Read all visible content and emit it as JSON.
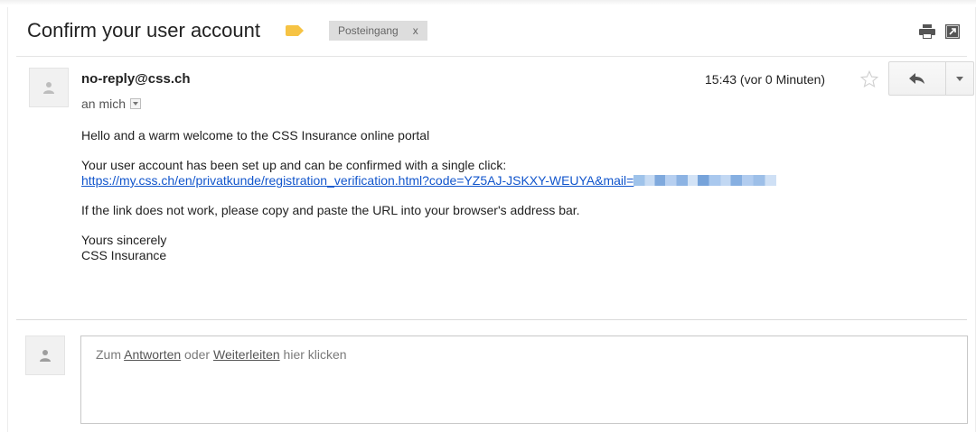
{
  "email": {
    "subject": "Confirm your user account",
    "label": "Posteingang",
    "label_remove": "x",
    "sender": "no-reply@css.ch",
    "recipient": "an mich",
    "timestamp": "15:43 (vor 0 Minuten)",
    "body": {
      "greeting": "Hello and a warm welcome to the CSS Insurance online portal",
      "paragraph_1": "Your user account has been set up and can be confirmed with a single click:",
      "link": "https://my.css.ch/en/privatkunde/registration_verification.html?code=YZ5AJ-JSKXY-WEUYA&mail=",
      "paragraph_2": "If the link does not work, please copy and paste the URL into your browser's address bar.",
      "closing_1": "Yours sincerely",
      "closing_2": "CSS Insurance"
    }
  },
  "reply_box": {
    "prefix": "Zum ",
    "reply_link": "Antworten",
    "middle": " oder ",
    "forward_link": "Weiterleiten",
    "suffix": " hier klicken"
  },
  "icons": {
    "print": "print-icon",
    "new_window": "open-in-new-window-icon",
    "star": "star-icon",
    "reply": "reply-arrow-icon",
    "more": "chevron-down-icon",
    "avatar": "person-icon",
    "importance": "importance-marker-icon"
  },
  "colors": {
    "link": "#1155cc",
    "importance": "#f6c344",
    "label_chip": "#dddddd"
  }
}
